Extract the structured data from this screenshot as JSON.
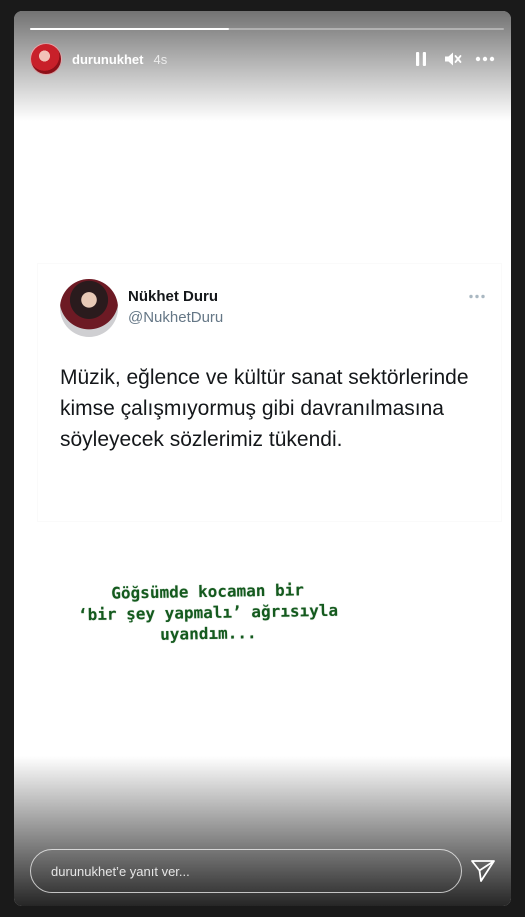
{
  "story": {
    "username": "durunukhet",
    "time_ago": "4s",
    "progress": 0.42
  },
  "icons": {
    "pause": "pause-icon",
    "mute": "speaker-muted-icon",
    "more": "more-horizontal-icon",
    "send": "paper-plane-icon"
  },
  "tweet": {
    "name": "Nükhet Duru",
    "handle": "@NukhetDuru",
    "text": "Müzik, eğlence ve kültür sanat sektörlerinde kimse çalışmıyormuş gibi davranılmasına söyleyecek sözlerimiz tükendi."
  },
  "caption": {
    "line1": "Göğsümde kocaman bir",
    "line2": "‘bir şey yapmalı’ ağrısıyla",
    "line3": "uyandım..."
  },
  "reply": {
    "placeholder": "durunukhet’e yanıt ver...",
    "value": ""
  },
  "colors": {
    "caption_green": "#145a1e",
    "handle_gray": "#657786"
  }
}
